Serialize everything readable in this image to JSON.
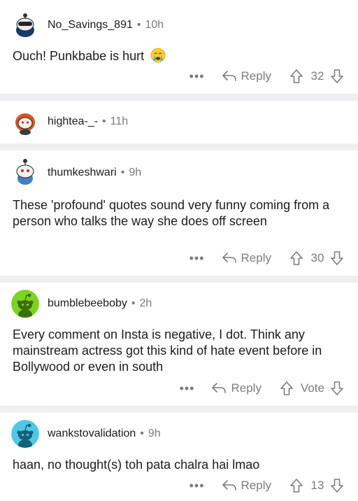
{
  "comments": [
    {
      "username": "No_Savings_891",
      "time": "10h",
      "text": "Ouch! Punkbabe is hurt",
      "emoji": "crying-face-icon",
      "reply_label": "Reply",
      "score": "32",
      "more_label": "•••"
    },
    {
      "username": "hightea-_-",
      "time": "11h"
    },
    {
      "username": "thumkeshwari",
      "time": "9h",
      "text": "These 'profound' quotes sound very funny coming from a person who talks the way she does off screen",
      "reply_label": "Reply",
      "score": "30",
      "more_label": "•••"
    },
    {
      "username": "bumblebeeboby",
      "time": "2h",
      "text": "Every comment on Insta is negative, I dot. Think any mainstream actress got this kind of hate event before in Bollywood or even in south",
      "reply_label": "Reply",
      "score": "Vote",
      "more_label": "•••"
    },
    {
      "username": "wankstovalidation",
      "time": "9h",
      "text": "haan, no thought(s) toh pata chalra hai lmao",
      "reply_label": "Reply",
      "score": "13",
      "more_label": "•••"
    }
  ],
  "separator": "•",
  "colors": {
    "background": "#ffffff",
    "divider": "#edeff1",
    "meta_text": "#7c7c7c",
    "body_text": "#1c1c1c",
    "avatar_green": "#7ed321",
    "avatar_cyan": "#4fc8e6"
  }
}
